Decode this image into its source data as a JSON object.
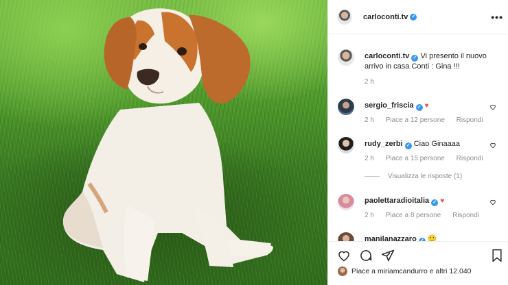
{
  "post": {
    "image_alt": "Puppy sitting on grass",
    "author": "carloconti.tv",
    "caption": "Vi presento il nuovo arrivo in casa Conti : Gina !!!",
    "caption_time": "2 h"
  },
  "header": {
    "username": "carloconti.tv",
    "more_icon": "more-horizontal-icon"
  },
  "comments": [
    {
      "username": "sergio_friscia",
      "text": "",
      "emoji": "♥",
      "time": "2 h",
      "likes": "Piace a 12 persone",
      "reply": "Rispondi"
    },
    {
      "username": "rudy_zerbi",
      "text": "Ciao Ginaaaa",
      "emoji": "",
      "time": "2 h",
      "likes": "Piace a 15 persone",
      "reply": "Rispondi"
    },
    {
      "username": "paolettaradioitalia",
      "text": "",
      "emoji": "♥",
      "time": "2 h",
      "likes": "Piace a 8 persone",
      "reply": "Rispondi"
    },
    {
      "username": "manilanazzaro",
      "text": "",
      "emoji": "🙂",
      "time": "",
      "likes": "",
      "reply": ""
    }
  ],
  "view_replies": "Visualizza le risposte (1)",
  "likes_summary": "Piace a miriamcandurro e altri 12.040",
  "colors": {
    "verified": "#3897f0",
    "heart": "#ed4956",
    "muted": "#8e8e8e"
  }
}
